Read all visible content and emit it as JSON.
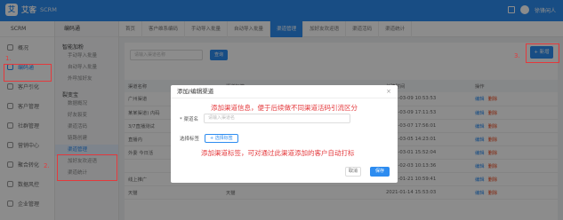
{
  "app": {
    "logo_mark": "艾",
    "name": "艾客",
    "sub": "SCRM",
    "user": "徐锋闲人"
  },
  "sidebar": {
    "brand": "SCRM",
    "items": [
      {
        "label": "概况",
        "icon": "home-icon"
      },
      {
        "label": "编码通",
        "icon": "people-icon"
      },
      {
        "label": "客户引化",
        "icon": "users-icon"
      },
      {
        "label": "客户管理",
        "icon": "user-icon"
      },
      {
        "label": "社群管理",
        "icon": "group-icon"
      },
      {
        "label": "营销中心",
        "icon": "megaphone-icon"
      },
      {
        "label": "聚合转化",
        "icon": "funnel-icon"
      },
      {
        "label": "数据风控",
        "icon": "shield-icon"
      },
      {
        "label": "企业管理",
        "icon": "building-icon"
      }
    ]
  },
  "submenu": {
    "header": "编码通",
    "groups": [
      {
        "title": "智能加粉",
        "links": [
          "手动导入批量",
          "自动导入批量",
          "外呼加好友"
        ]
      },
      {
        "title": "裂变宝",
        "links": [
          "数据概况",
          "好友裂变",
          "渠道活码"
        ]
      },
      {
        "title": "",
        "links": [
          "链路创建",
          "渠道管理",
          "加好友欢迎语",
          "渠道统计"
        ]
      }
    ],
    "active_link": "渠道管理"
  },
  "tabs": [
    "首页",
    "客户维系编码",
    "手动导入批量",
    "自动导入批量",
    "渠道管理",
    "加好友欢迎语",
    "渠道活码",
    "渠道统计"
  ],
  "active_tab": "渠道管理",
  "main": {
    "search_placeholder": "请输入渠道名称",
    "query_label": "查询",
    "add_label": "+ 新增",
    "columns": [
      "渠道名称",
      "渠道标签",
      "创建时间",
      "操作"
    ],
    "rows": [
      {
        "name": "广州渠道",
        "tag": "",
        "time": "2021-03-09 10:53:53"
      },
      {
        "name": "某某渠道) 内码",
        "tag": "",
        "time": "2021-03-09 17:11:53"
      },
      {
        "name": "3/7直播测试",
        "tag": "",
        "time": "2021-03-07 17:56:01"
      },
      {
        "name": "直播内",
        "tag": "",
        "time": "2021-03-05 14:23:01"
      },
      {
        "name": "外委 今日活",
        "tag": "",
        "time": "2021-03-01 15:52:04"
      },
      {
        "name": "",
        "tag": "",
        "time": "2021-02-03 10:13:36"
      },
      {
        "name": "线上推广",
        "tag": "线上推广  来源渠道",
        "time": "2021-01-21 10:59:41"
      },
      {
        "name": "天猫",
        "tag": "天猫",
        "time": "2021-01-14 15:53:03"
      }
    ],
    "op_edit": "编辑",
    "op_delete": "删除"
  },
  "modal": {
    "title": "添加/编辑渠道",
    "close": "×",
    "name_label": "* 渠道名",
    "name_placeholder": "请输入渠道名",
    "tag_label": "选择标签",
    "tag_button": "+ 选择标签",
    "cancel": "取消",
    "save": "保存"
  },
  "annotations": {
    "a1": "添加渠道信息，便于后续做不同渠道活码引流区分",
    "a2": "添加渠道标签，可对通过此渠道添加的客户自动打标",
    "n1": "1.",
    "n2": "2.",
    "n3": "3."
  },
  "colors": {
    "primary": "#2d8cf0",
    "annotation": "#e4393c"
  }
}
